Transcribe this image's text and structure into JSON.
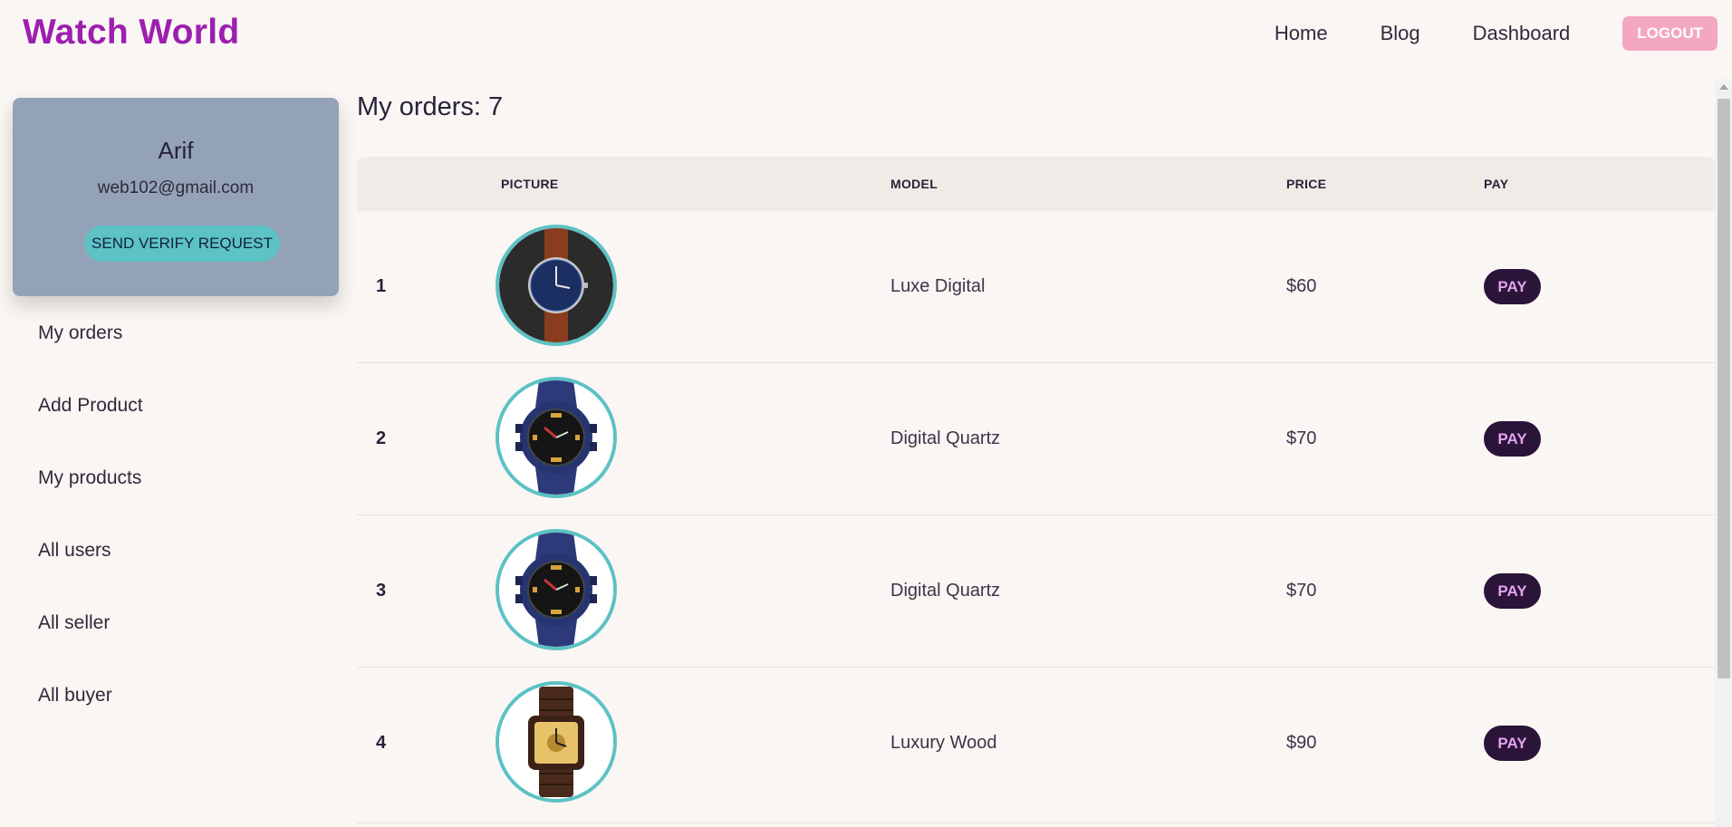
{
  "brand": {
    "title": "Watch World",
    "color": "#9c1fb0"
  },
  "nav": {
    "links": [
      "Home",
      "Blog",
      "Dashboard"
    ],
    "logout_label": "LOGOUT"
  },
  "profile": {
    "name": "Arif",
    "email": "web102@gmail.com",
    "verify_label": "SEND VERIFY REQUEST"
  },
  "sidebar": {
    "items": [
      "My orders",
      "Add Product",
      "My products",
      "All users",
      "All seller",
      "All buyer"
    ]
  },
  "orders": {
    "title": "My orders: 7",
    "columns": [
      "",
      "PICTURE",
      "MODEL",
      "PRICE",
      "PAY"
    ],
    "rows": [
      {
        "num": "1",
        "image_icon": "watch-brown-leather-blue-dial-icon",
        "model": "Luxe Digital",
        "price": "$60",
        "pay": "PAY"
      },
      {
        "num": "2",
        "image_icon": "watch-blue-camo-sport-icon",
        "model": "Digital Quartz",
        "price": "$70",
        "pay": "PAY"
      },
      {
        "num": "3",
        "image_icon": "watch-blue-camo-sport-icon",
        "model": "Digital Quartz",
        "price": "$70",
        "pay": "PAY"
      },
      {
        "num": "4",
        "image_icon": "watch-wood-square-gold-dial-icon",
        "model": "Luxury Wood",
        "price": "$90",
        "pay": "PAY"
      }
    ]
  },
  "colors": {
    "accent_teal": "#5cc2c4",
    "pay_button": "#2a1438",
    "logout_button": "#f4a7c2",
    "profile_card": "#94a2b8"
  }
}
